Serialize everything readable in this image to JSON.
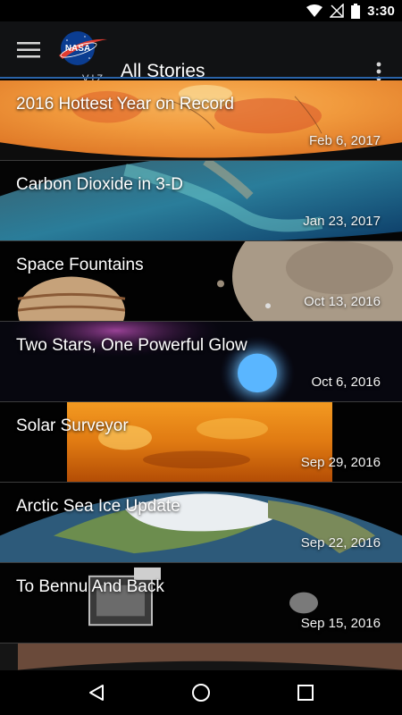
{
  "status_bar": {
    "time": "3:30",
    "icons": [
      "wifi-icon",
      "no-signal-icon",
      "battery-icon"
    ]
  },
  "app_bar": {
    "title": "All Stories",
    "logo_text": "NASA",
    "logo_sub": "VIZ",
    "icons": [
      "menu-icon",
      "overflow-menu-icon"
    ]
  },
  "stories": [
    {
      "title": "2016 Hottest Year on Record",
      "date": "Feb 6, 2017"
    },
    {
      "title": "Carbon Dioxide in 3-D",
      "date": "Jan 23, 2017"
    },
    {
      "title": "Space Fountains",
      "date": "Oct 13, 2016"
    },
    {
      "title": "Two Stars, One Powerful Glow",
      "date": "Oct 6, 2016"
    },
    {
      "title": "Solar Surveyor",
      "date": "Sep 29, 2016"
    },
    {
      "title": "Arctic Sea Ice Update",
      "date": "Sep 22, 2016"
    },
    {
      "title": "To Bennu And Back",
      "date": "Sep 15, 2016"
    }
  ],
  "nav_bar": {
    "icons": [
      "back-icon",
      "home-icon",
      "recents-icon"
    ]
  }
}
